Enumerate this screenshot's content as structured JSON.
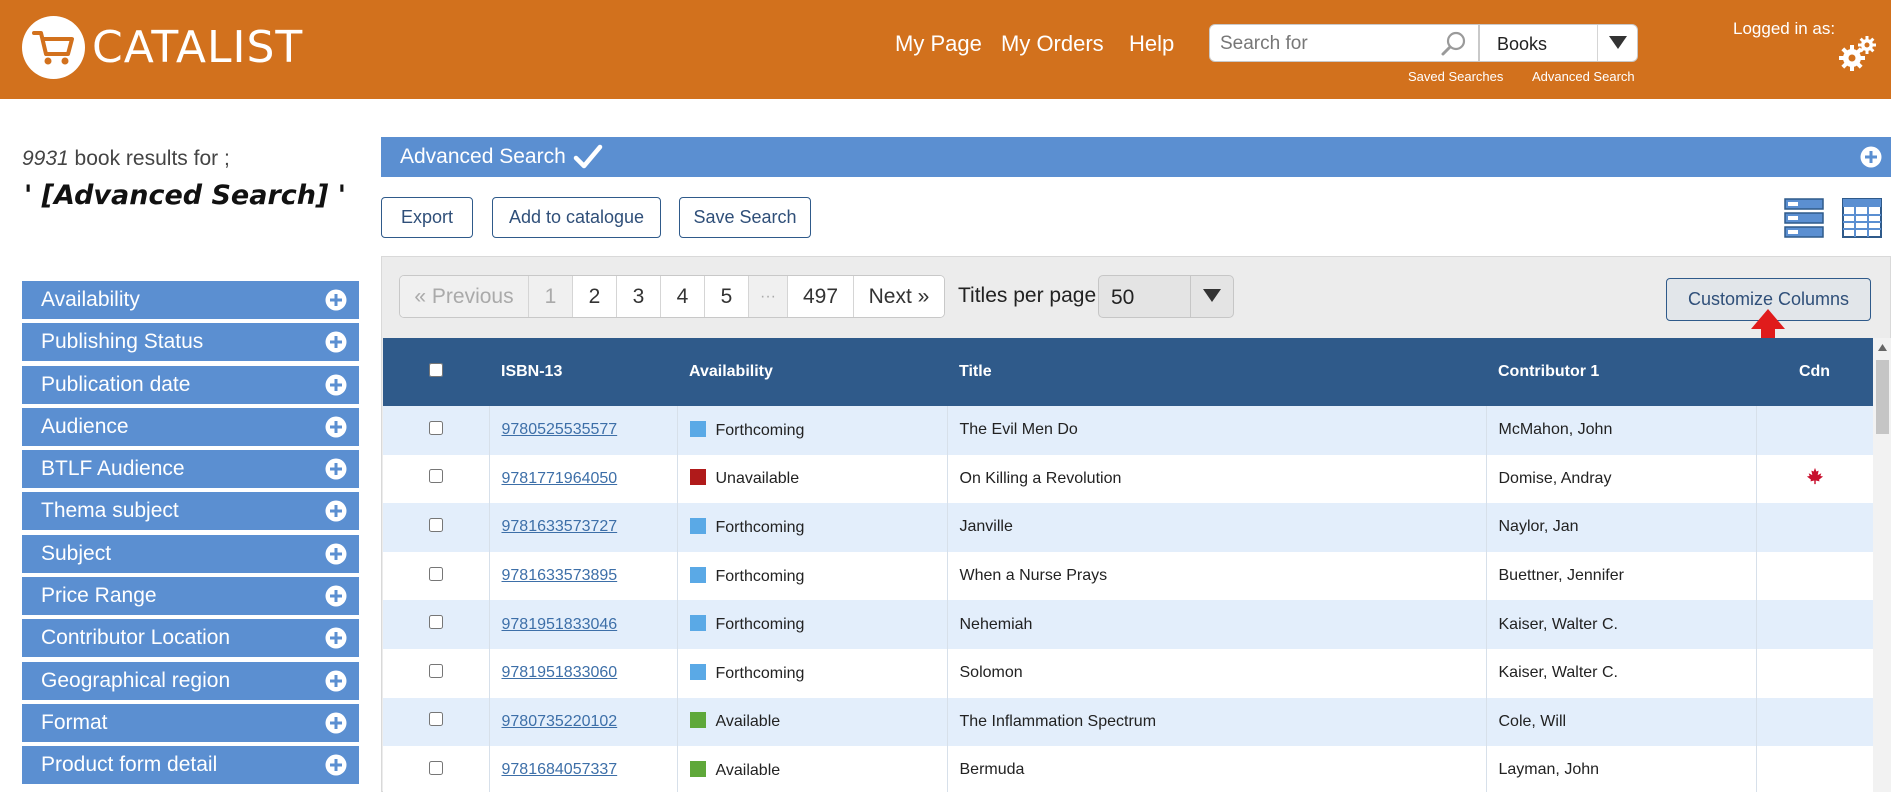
{
  "header": {
    "logo_text": "CATALIST",
    "nav": [
      "My Page",
      "My Orders",
      "Help"
    ],
    "search_placeholder": "Search for",
    "search_type": "Books",
    "saved_searches": "Saved Searches",
    "advanced_search": "Advanced Search",
    "logged_in": "Logged in as:"
  },
  "results": {
    "count": "9931",
    "summary_suffix": " book results for ;",
    "query": "' [Advanced Search] '"
  },
  "facets": [
    "Availability",
    "Publishing Status",
    "Publication date",
    "Audience",
    "BTLF Audience",
    "Thema subject",
    "Subject",
    "Price Range",
    "Contributor Location",
    "Geographical region",
    "Format",
    "Product form detail"
  ],
  "adv_bar": {
    "title": "Advanced Search"
  },
  "actions": {
    "export": "Export",
    "add_to_catalogue": "Add to catalogue",
    "save_search": "Save Search"
  },
  "pager": {
    "previous": "« Previous",
    "pages": [
      "1",
      "2",
      "3",
      "4",
      "5"
    ],
    "ellipsis": "···",
    "last_page": "497",
    "next": "Next »",
    "titles_per_page": "Titles per page",
    "per_page": "50"
  },
  "customize_columns": "Customize Columns",
  "table": {
    "columns": [
      "ISBN-13",
      "Availability",
      "Title",
      "Contributor 1",
      "Cdn"
    ],
    "rows": [
      {
        "isbn": "9780525535577",
        "availability": "Forthcoming",
        "title": "The Evil Men Do",
        "contributor": "McMahon, John",
        "cdn": false
      },
      {
        "isbn": "9781771964050",
        "availability": "Unavailable",
        "title": "On Killing a Revolution",
        "contributor": "Domise, Andray",
        "cdn": true
      },
      {
        "isbn": "9781633573727",
        "availability": "Forthcoming",
        "title": "Janville",
        "contributor": "Naylor, Jan",
        "cdn": false
      },
      {
        "isbn": "9781633573895",
        "availability": "Forthcoming",
        "title": "When a Nurse Prays",
        "contributor": "Buettner, Jennifer",
        "cdn": false
      },
      {
        "isbn": "9781951833046",
        "availability": "Forthcoming",
        "title": "Nehemiah",
        "contributor": "Kaiser, Walter C.",
        "cdn": false
      },
      {
        "isbn": "9781951833060",
        "availability": "Forthcoming",
        "title": "Solomon",
        "contributor": "Kaiser, Walter C.",
        "cdn": false
      },
      {
        "isbn": "9780735220102",
        "availability": "Available",
        "title": "The Inflammation Spectrum",
        "contributor": "Cole, Will",
        "cdn": false
      },
      {
        "isbn": "9781684057337",
        "availability": "Available",
        "title": "Bermuda",
        "contributor": "Layman, John",
        "cdn": false
      }
    ]
  },
  "colors": {
    "header": "#d2711d",
    "facet": "#5b8fd1",
    "table_header": "#2f5a8a",
    "forthcoming": "#5aa9e6",
    "unavailable": "#b01a1a",
    "available": "#5fa83a",
    "arrow": "#e01b1b"
  }
}
